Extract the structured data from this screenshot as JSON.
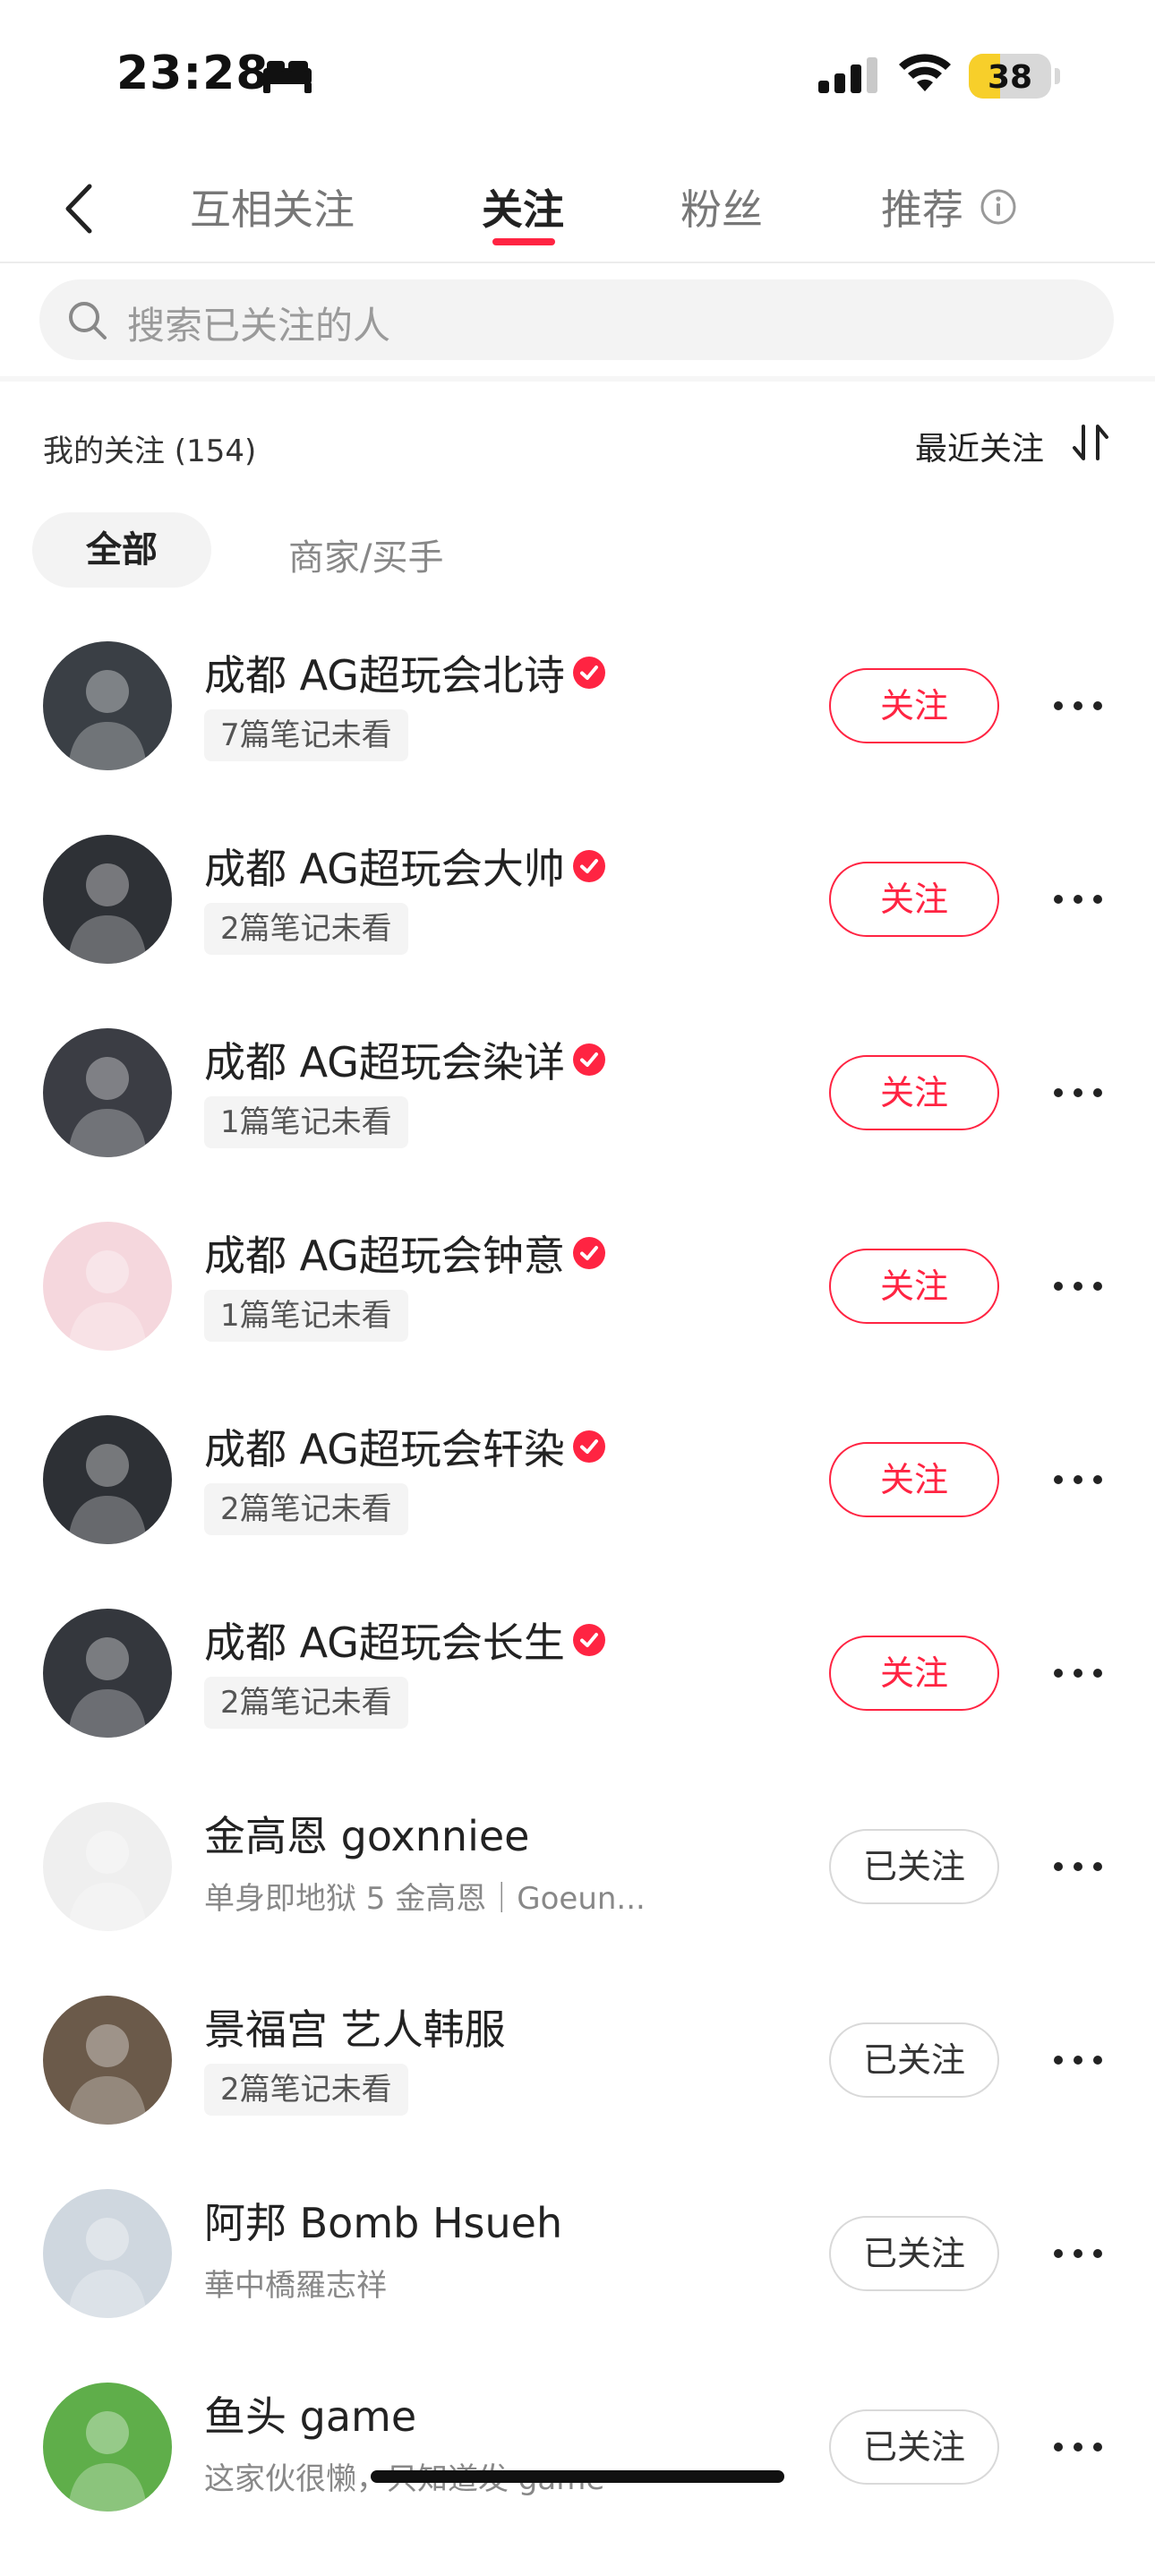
{
  "status_bar": {
    "time": "23:28",
    "battery": "38",
    "battery_level": 0.38
  },
  "nav": {
    "tabs": [
      {
        "label": "互相关注",
        "active": false
      },
      {
        "label": "关注",
        "active": true
      },
      {
        "label": "粉丝",
        "active": false
      },
      {
        "label": "推荐",
        "active": false
      }
    ]
  },
  "search": {
    "placeholder": "搜索已关注的人"
  },
  "list_header": {
    "count_label": "我的关注 (154)",
    "sort_label": "最近关注"
  },
  "filters": {
    "all": "全部",
    "merchant": "商家/买手"
  },
  "accent": "#ff2442",
  "users": [
    {
      "name": "成都 AG超玩会北诗",
      "verified": true,
      "sub": "7篇笔记未看",
      "sub_type": "tag",
      "button": "关注",
      "state": "follow",
      "avatar_bg": "#3a3f45"
    },
    {
      "name": "成都 AG超玩会大帅",
      "verified": true,
      "sub": "2篇笔记未看",
      "sub_type": "tag",
      "button": "关注",
      "state": "follow",
      "avatar_bg": "#2e3136"
    },
    {
      "name": "成都 AG超玩会染详",
      "verified": true,
      "sub": "1篇笔记未看",
      "sub_type": "tag",
      "button": "关注",
      "state": "follow",
      "avatar_bg": "#3b3d44"
    },
    {
      "name": "成都 AG超玩会钟意",
      "verified": true,
      "sub": "1篇笔记未看",
      "sub_type": "tag",
      "button": "关注",
      "state": "follow",
      "avatar_bg": "#f5d7dd"
    },
    {
      "name": "成都 AG超玩会轩染",
      "verified": true,
      "sub": "2篇笔记未看",
      "sub_type": "tag",
      "button": "关注",
      "state": "follow",
      "avatar_bg": "#2d3035"
    },
    {
      "name": "成都 AG超玩会长生",
      "verified": true,
      "sub": "2篇笔记未看",
      "sub_type": "tag",
      "button": "关注",
      "state": "follow",
      "avatar_bg": "#34373d"
    },
    {
      "name": "金高恩 goxnniee",
      "verified": false,
      "sub": "单身即地狱 5 金高恩｜Goeun...",
      "sub_type": "text",
      "button": "已关注",
      "state": "followed",
      "avatar_bg": "#efefef"
    },
    {
      "name": "景福宫 艺人韩服",
      "verified": false,
      "sub": "2篇笔记未看",
      "sub_type": "tag",
      "button": "已关注",
      "state": "followed",
      "avatar_bg": "#6b5a4a"
    },
    {
      "name": "阿邦 Bomb Hsueh",
      "verified": false,
      "sub": "華中橋羅志祥",
      "sub_type": "text",
      "button": "已关注",
      "state": "followed",
      "avatar_bg": "#cfd7df"
    },
    {
      "name": "鱼头 game",
      "verified": false,
      "sub": "这家伙很懒，只知道发 game",
      "sub_type": "text",
      "button": "已关注",
      "state": "followed",
      "avatar_bg": "#5fae4a"
    }
  ]
}
